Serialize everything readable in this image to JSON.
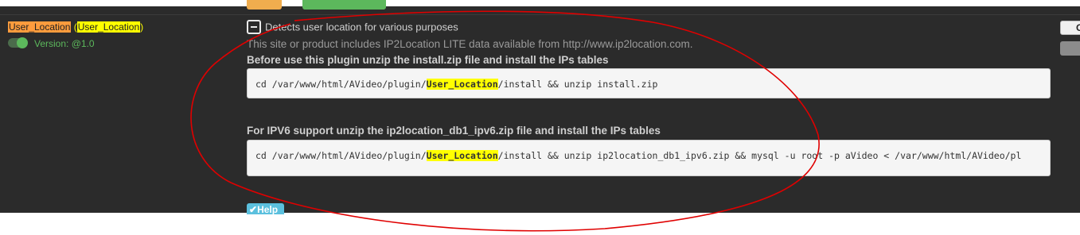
{
  "plugin": {
    "name": "User_Location",
    "directory": "User_Location",
    "version_label": "Version: @1.0",
    "enabled": true
  },
  "description": "Detects user location for various purposes",
  "ip2location_note": "This site or product includes IP2Location LITE data available from http://www.ip2location.com.",
  "install": {
    "heading": "Before use this plugin unzip the install.zip file and install the IPs tables",
    "cmd_prefix": "cd /var/www/html/AVideo/plugin/",
    "cmd_highlight": "User_Location",
    "cmd_suffix": "/install && unzip install.zip"
  },
  "ipv6": {
    "heading": "For IPV6 support unzip the ip2location_db1_ipv6.zip file and install the IPs tables",
    "cmd_prefix": "cd /var/www/html/AVideo/plugin/",
    "cmd_highlight": "User_Location",
    "cmd_suffix": "/install && unzip ip2location_db1_ipv6.zip && mysql -u root -p aVideo <  /var/www/html/AVideo/pl"
  },
  "help_button": "Help",
  "right_button_label": "G",
  "colors": {
    "panel_bg": "#2b2b2b",
    "highlight": "#ffff00",
    "name_highlight": "#ff9c3d",
    "enabled_green": "#5cb85c",
    "annotation_red": "#e00000",
    "help_blue": "#5bc0de"
  }
}
